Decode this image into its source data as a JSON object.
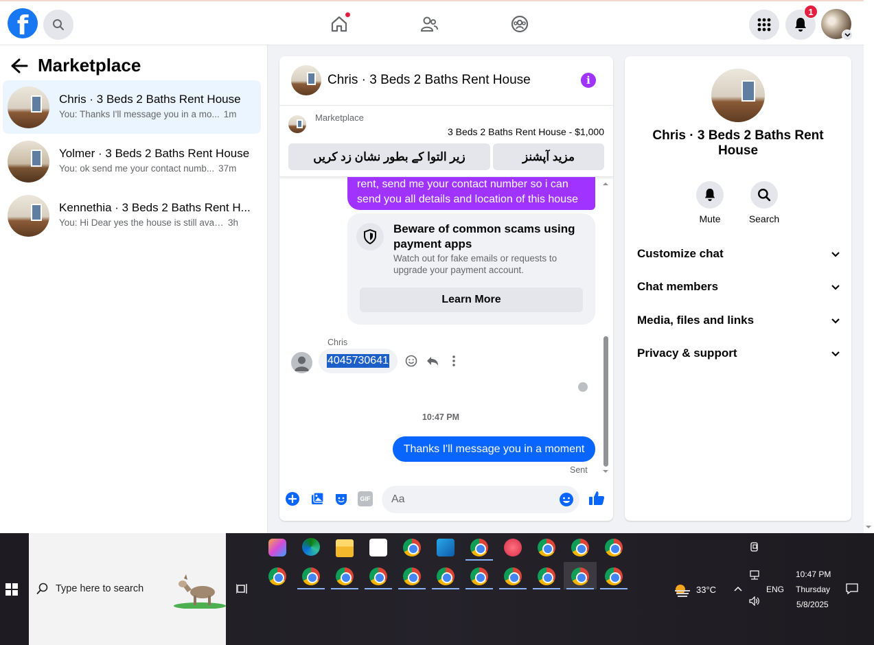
{
  "topbar": {
    "logo_letter": "f",
    "notifications_count": "1"
  },
  "left": {
    "title": "Marketplace",
    "conversations": [
      {
        "title": "Chris · 3 Beds 2 Baths Rent House",
        "preview": "You: Thanks I'll message you in a mo...",
        "time": "1m"
      },
      {
        "title": "Yolmer · 3 Beds 2 Baths Rent House",
        "preview": "You: ok send me your contact numb...",
        "time": "37m"
      },
      {
        "title": "Kennethia · 3 Beds 2 Baths Rent H...",
        "preview": "You: Hi Dear yes the house is still avail...",
        "time": "3h"
      }
    ]
  },
  "chat": {
    "title": "Chris · 3 Beds 2 Baths Rent House",
    "marketplace_label": "Marketplace",
    "listing": "3 Beds 2 Baths Rent House - $1,000",
    "btn_mark": "زیر التوا کے بطور نشان زد کریں",
    "btn_more": "مزید آپشنز",
    "purple_msg": "rent, send me your contact number so i can send you all details and location of this house",
    "scam_title": "Beware of common scams using payment apps",
    "scam_sub": "Watch out for fake emails or requests to upgrade your payment account.",
    "learn_more": "Learn More",
    "sender": "Chris",
    "phone_msg": "4045730641",
    "timestamp": "10:47 PM",
    "blue_msg": "Thanks I'll message you in a moment",
    "sent": "Sent",
    "input_placeholder": "Aa",
    "gif_label": "GIF"
  },
  "right": {
    "name": "Chris · 3 Beds 2 Baths Rent House",
    "mute": "Mute",
    "search": "Search",
    "rows": [
      "Customize chat",
      "Chat members",
      "Media, files and links",
      "Privacy & support"
    ]
  },
  "taskbar": {
    "search_placeholder": "Type here to search",
    "temperature": "33°C",
    "lang": "ENG",
    "time": "10:47 PM",
    "day": "Thursday",
    "date": "5/8/2025"
  },
  "colors": {
    "brand": "#1877f2",
    "purple": "#a033ff",
    "blue_bubble": "#0866ff",
    "active_row": "#ebf5ff"
  }
}
